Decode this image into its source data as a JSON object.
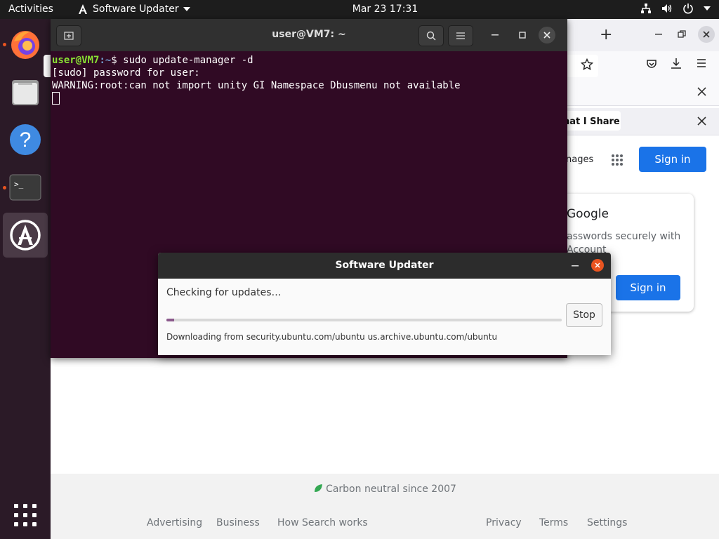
{
  "topbar": {
    "activities": "Activities",
    "app_name": "Software Updater",
    "clock": "Mar 23  17:31"
  },
  "dock": {
    "items": [
      "firefox-icon",
      "files-icon",
      "help-icon",
      "terminal-icon",
      "software-updater-icon"
    ],
    "show_apps": "show-applications-icon"
  },
  "browser": {
    "notice1_text": "",
    "notice2_text": "hat I Share",
    "images_link": "nages",
    "signin_button": "Sign in",
    "card_title": "Google",
    "card_line1": "asswords securely with",
    "card_line2": "Account",
    "card_signin": "Sign in",
    "footer": {
      "carbon": "Carbon neutral since 2007",
      "links_left": [
        "Advertising",
        "Business",
        "How Search works"
      ],
      "links_right": [
        "Privacy",
        "Terms",
        "Settings"
      ]
    }
  },
  "terminal": {
    "title": "user@VM7: ~",
    "prompt_user": "user@VM7",
    "prompt_path": ":~",
    "prompt_symbol": "$ ",
    "command": "sudo update-manager -d",
    "line2": "[sudo] password for user:",
    "line3": "WARNING:root:can not import unity GI Namespace Dbusmenu not available"
  },
  "updater": {
    "title": "Software Updater",
    "status": "Checking for updates…",
    "progress": 0.02,
    "stop_label": "Stop",
    "details": "Downloading from security.ubuntu.com/ubuntu us.archive.ubuntu.com/ubuntu"
  },
  "colors": {
    "terminal_bg": "#300a24",
    "accent": "#e95420",
    "google_blue": "#1a73e8"
  }
}
